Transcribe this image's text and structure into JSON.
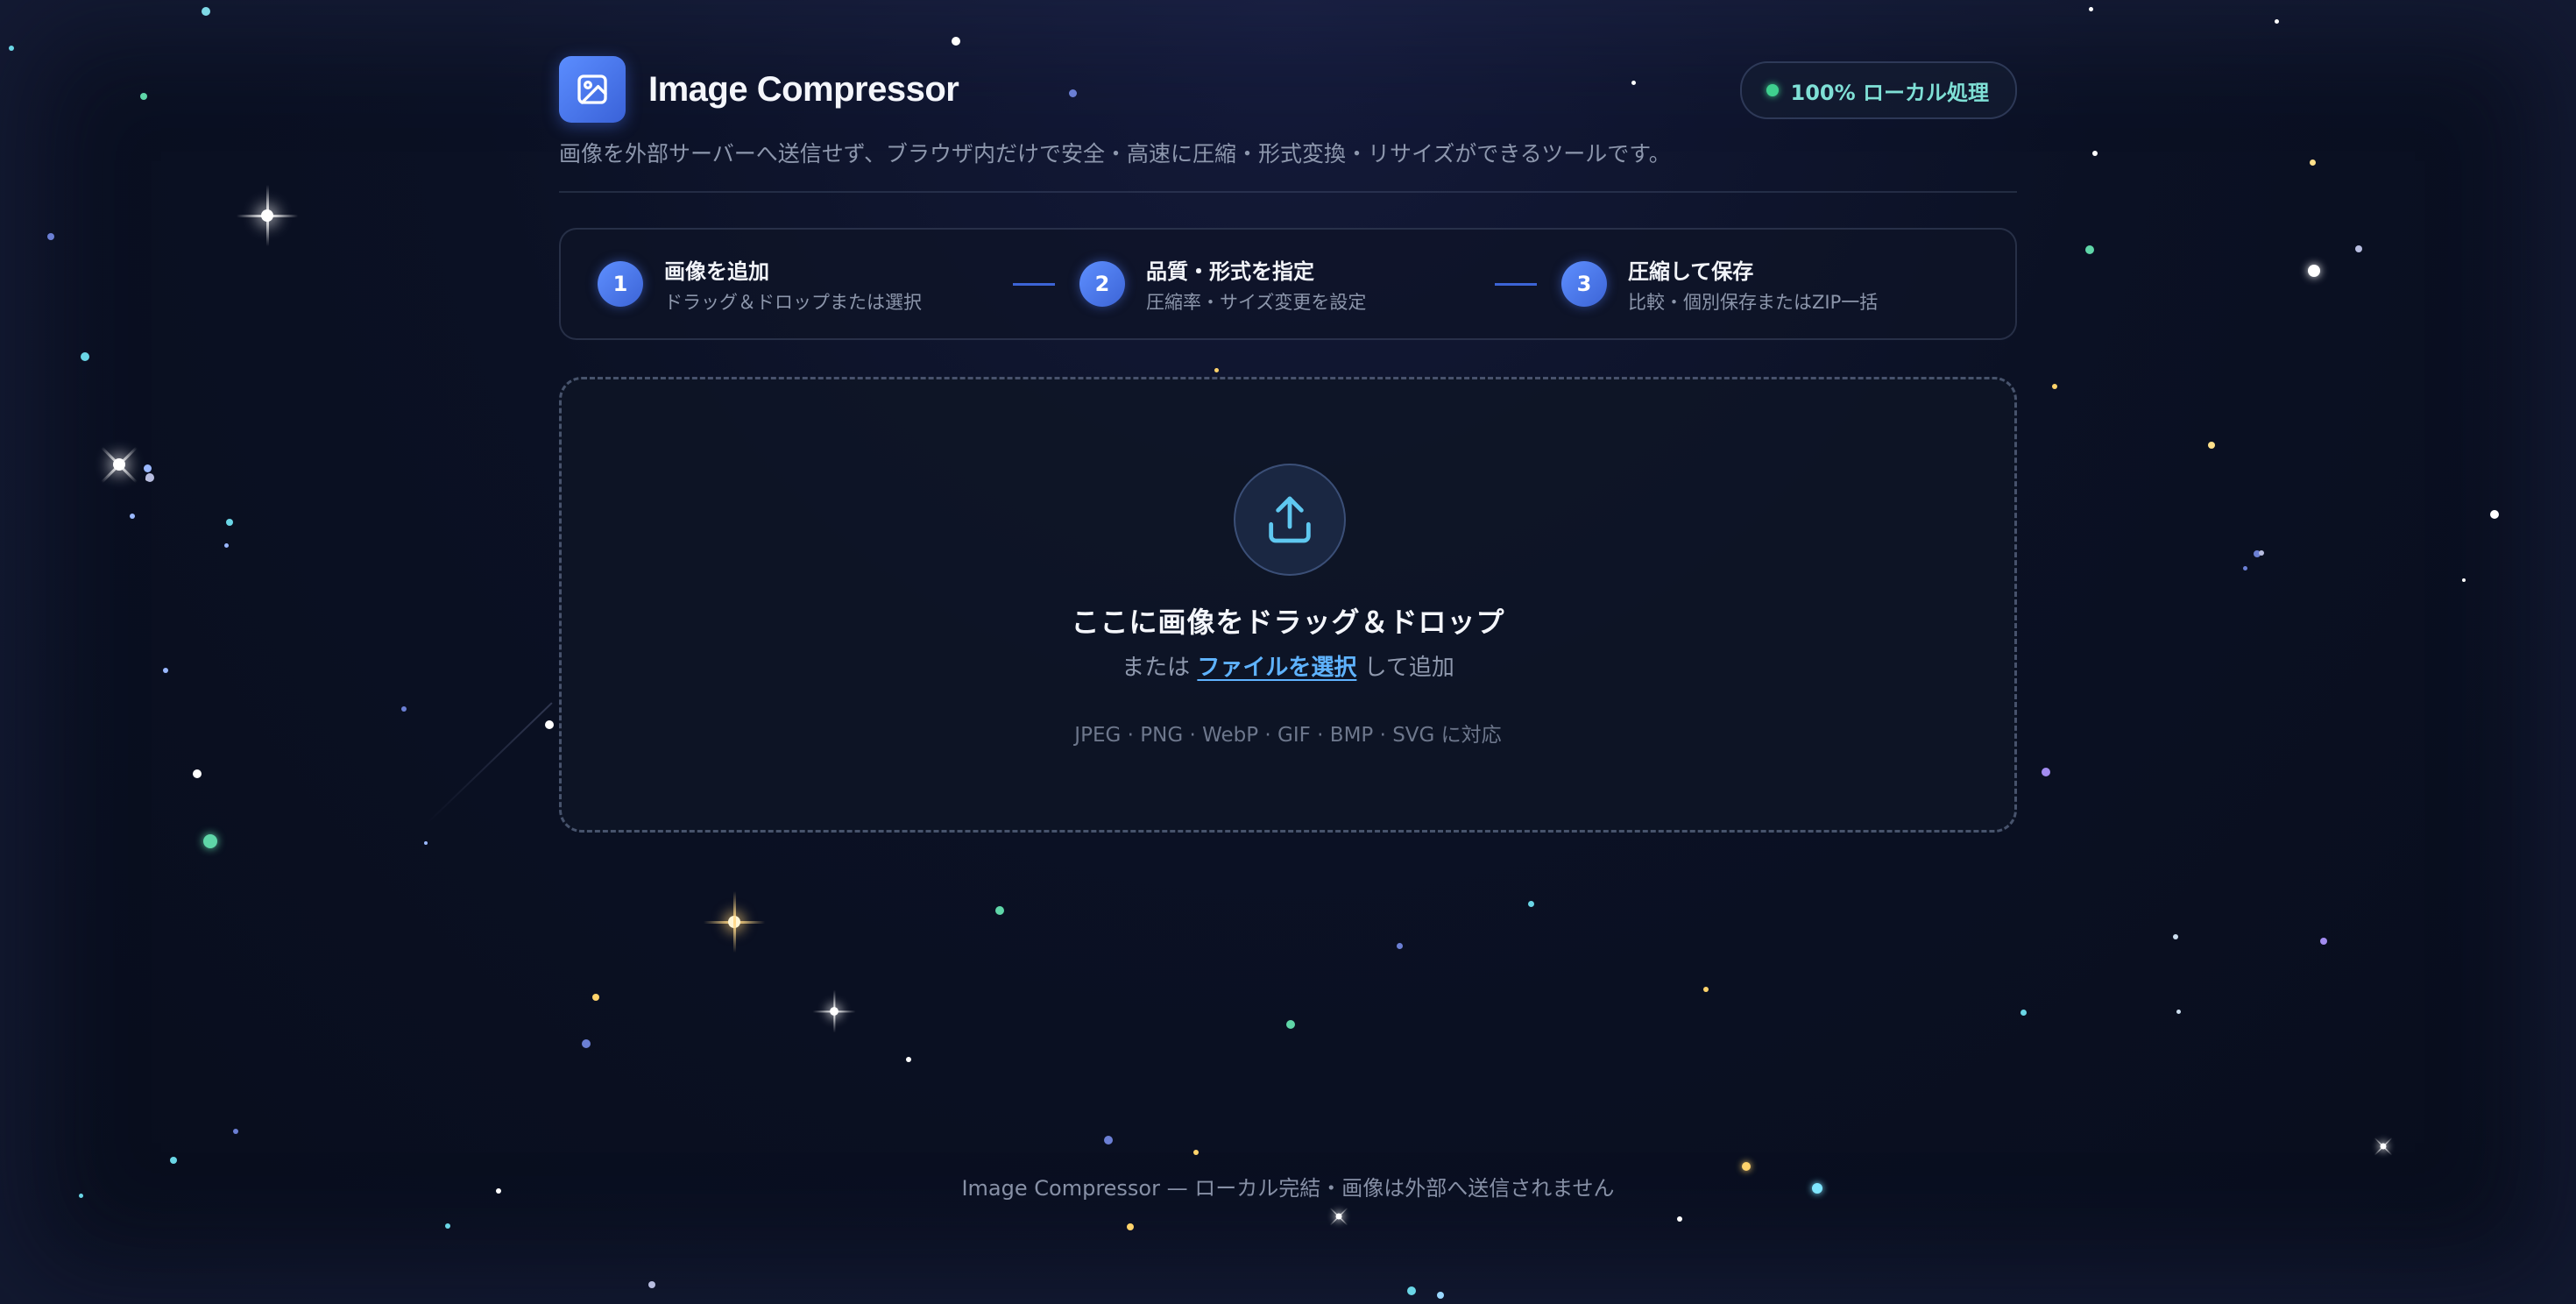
{
  "header": {
    "title": "Image Compressor",
    "badge": "100% ローカル処理",
    "subtitle": "画像を外部サーバーへ送信せず、ブラウザ内だけで安全・高速に圧縮・形式変換・リサイズができるツールです。"
  },
  "steps": [
    {
      "num": "1",
      "title": "画像を追加",
      "sub": "ドラッグ＆ドロップまたは選択"
    },
    {
      "num": "2",
      "title": "品質・形式を指定",
      "sub": "圧縮率・サイズ変更を設定"
    },
    {
      "num": "3",
      "title": "圧縮して保存",
      "sub": "比較・個別保存またはZIP一括"
    }
  ],
  "dropzone": {
    "title": "ここに画像をドラッグ＆ドロップ",
    "prefix": "または",
    "link": "ファイルを選択",
    "suffix": "して追加",
    "formats": "JPEG · PNG · WebP · GIF · BMP · SVG に対応"
  },
  "footer": "Image Compressor — ローカル完結・画像は外部へ送信されません",
  "icons": {
    "logo": "image-icon",
    "upload": "upload-icon",
    "badge_status": "status-dot"
  },
  "colors": {
    "accent": "#4a78f0",
    "link": "#5fb3ff",
    "badge_text": "#7fe0d6",
    "status_dot": "#3fd08e"
  }
}
